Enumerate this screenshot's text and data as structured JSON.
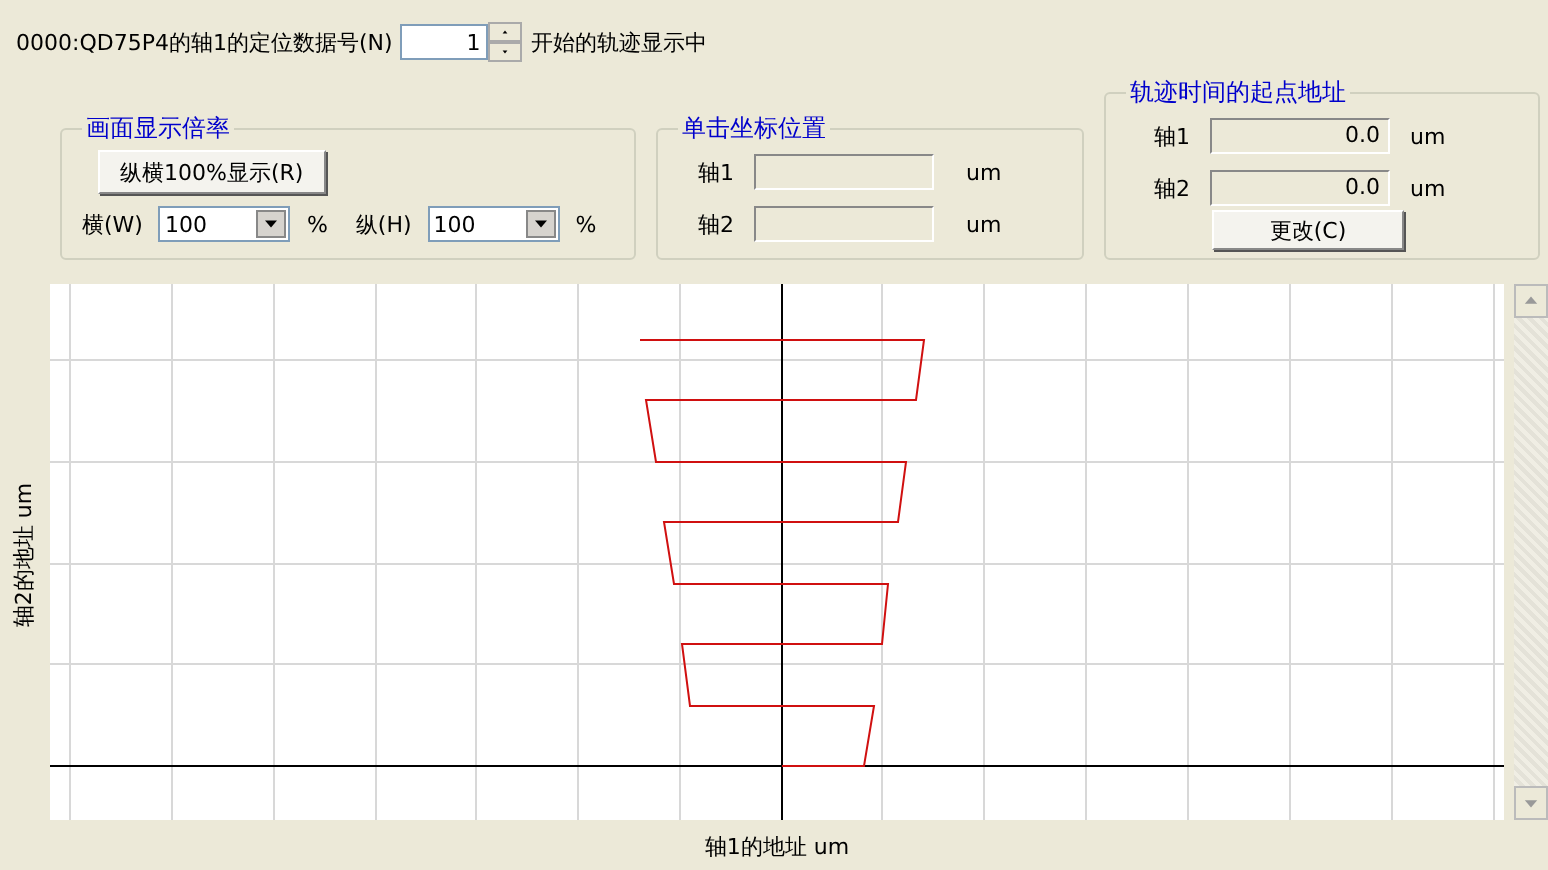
{
  "header": {
    "prefix": "0000:QD75P4的轴1的定位数据号(N)",
    "data_number": "1",
    "suffix": "开始的轨迹显示中"
  },
  "zoom_group": {
    "title": "画面显示倍率",
    "reset_button": "纵横100%显示(R)",
    "combos": [
      {
        "label": "横(W)",
        "value": "100",
        "unit": "%"
      },
      {
        "label": "纵(H)",
        "value": "100",
        "unit": "%"
      }
    ]
  },
  "click_position": {
    "title": "单击坐标位置",
    "rows": [
      {
        "label": "轴1",
        "unit": "um"
      },
      {
        "label": "轴2",
        "unit": "um"
      }
    ]
  },
  "start_address": {
    "title": "轨迹时间的起点地址",
    "rows": [
      {
        "label": "轴1",
        "value": "0.0",
        "unit": "um"
      },
      {
        "label": "轴2",
        "value": "0.0",
        "unit": "um"
      }
    ],
    "change_button": "更改(C)"
  },
  "plot": {
    "xlabel": "轴1的地址 um",
    "ylabel": "轴2的地址 um"
  }
}
